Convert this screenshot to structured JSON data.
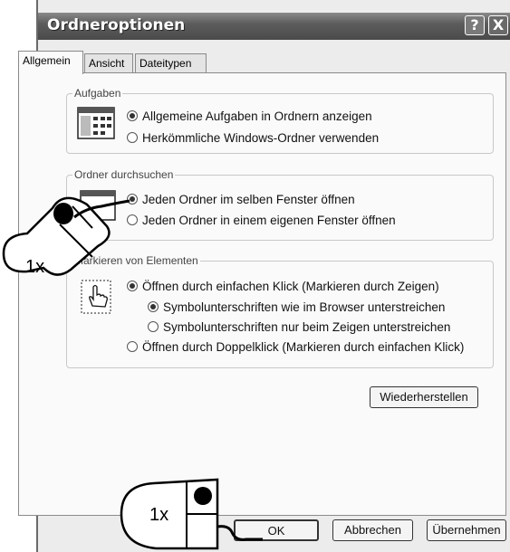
{
  "window": {
    "title": "Ordneroptionen"
  },
  "titlebar_buttons": {
    "help": "?",
    "close": "X"
  },
  "tabs": [
    {
      "label": "Allgemein",
      "active": true
    },
    {
      "label": "Ansicht",
      "active": false
    },
    {
      "label": "Dateitypen",
      "active": false
    }
  ],
  "groups": {
    "tasks": {
      "title": "Aufgaben",
      "options": [
        {
          "label": "Allgemeine Aufgaben in Ordnern anzeigen",
          "selected": true
        },
        {
          "label": "Herkömmliche Windows-Ordner verwenden",
          "selected": false
        }
      ]
    },
    "browse": {
      "title": "Ordner durchsuchen",
      "options": [
        {
          "label": "Jeden Ordner im selben Fenster öffnen",
          "selected": true
        },
        {
          "label": "Jeden Ordner in einem eigenen Fenster öffnen",
          "selected": false
        }
      ]
    },
    "click": {
      "title": "Markieren von Elementen",
      "options": [
        {
          "label": "Öffnen durch einfachen Klick (Markieren durch Zeigen)",
          "selected": true
        },
        {
          "label": "Symbolunterschriften wie im Browser unterstreichen",
          "selected": true
        },
        {
          "label": "Symbolunterschriften nur beim Zeigen unterstreichen",
          "selected": false
        },
        {
          "label": "Öffnen durch Doppelklick (Markieren durch einfachen Klick)",
          "selected": false
        }
      ]
    }
  },
  "buttons": {
    "restore": "Wiederherstellen",
    "ok": "OK",
    "cancel": "Abbrechen",
    "apply": "Übernehmen"
  },
  "annotations": {
    "click_top": "1x",
    "click_bottom": "1x"
  }
}
